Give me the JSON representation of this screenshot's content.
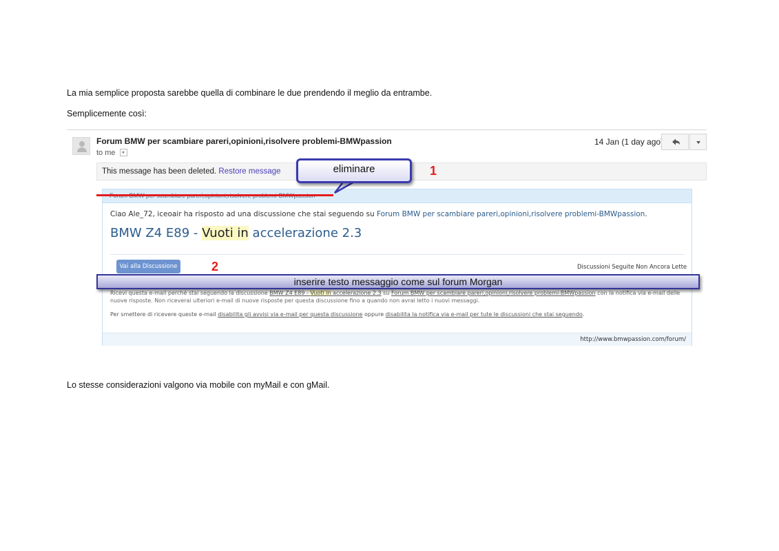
{
  "doc": {
    "paragraph1": "La mia semplice proposta sarebbe quella di combinare le due prendendo il meglio da entrambe.",
    "paragraph2": "Semplicemente così:",
    "paragraph3": "Lo stesse considerazioni valgono via mobile con myMail e con gMail."
  },
  "email": {
    "sender": "Forum BMW per scambiare pareri,opinioni,risolvere problemi-BMWpassion",
    "recipient": "to me",
    "date": "14 Jan (1 day ago)",
    "deleted_text": "This message has been deleted.",
    "restore_label": "Restore message",
    "icons": {
      "avatar": "person-icon",
      "reply": "reply-arrow-icon",
      "more": "chevron-down-icon"
    }
  },
  "forum_card": {
    "header": "Forum BMW per scambiare pareri,opinioni,risolvere problemi-BMWpassion",
    "greeting_prefix": "Ciao Ale_72, iceoair ha risposto ad una discussione che stai seguendo su ",
    "greeting_link": "Forum BMW per scambiare pareri,opinioni,risolvere problemi-BMWpassion",
    "greeting_suffix": ".",
    "title_part1": "BMW Z4 E89 - ",
    "title_highlight": "Vuoti in",
    "title_part2": " accelerazione 2.3",
    "button_label": "Vai alla Discussione",
    "followed_label": "Discussioni Seguite Non Ancora Lette",
    "body_part1": "Ricevi questa e-mail perché stai seguendo la discussione ",
    "body_link1a": "BMW Z4 E89 - ",
    "body_link1_hl": "Vuoti in",
    "body_link1b": " accelerazione 2.3",
    "body_part2": " su ",
    "body_link2": "Forum BMW per scambiare pareri,opinioni,risolvere problemi-BMWpassion",
    "body_part3": " con la notifica via e-mail delle nuove risposte. Non riceverai ulteriori e-mail di nuove risposte per questa discussione fino a quando non avrai letto i nuovi messaggi.",
    "unsub_prefix": "Per smettere di ricevere queste e-mail ",
    "unsub_link1": "disabilita gli avvisi via e-mail per questa discussione",
    "unsub_middle": " oppure ",
    "unsub_link2": "disabilita la notifica via e-mail per tute le discussioni che stai seguendo",
    "unsub_suffix": ".",
    "footer_url": "http://www.bmwpassion.com/forum/"
  },
  "annotations": {
    "callout1_text": "eliminare",
    "number1": "1",
    "number2": "2",
    "bar2_text": "inserire testo messaggio come sul forum Morgan",
    "colors": {
      "mark_red": "#e41c1c",
      "callout_border": "#3a3ab0"
    }
  }
}
